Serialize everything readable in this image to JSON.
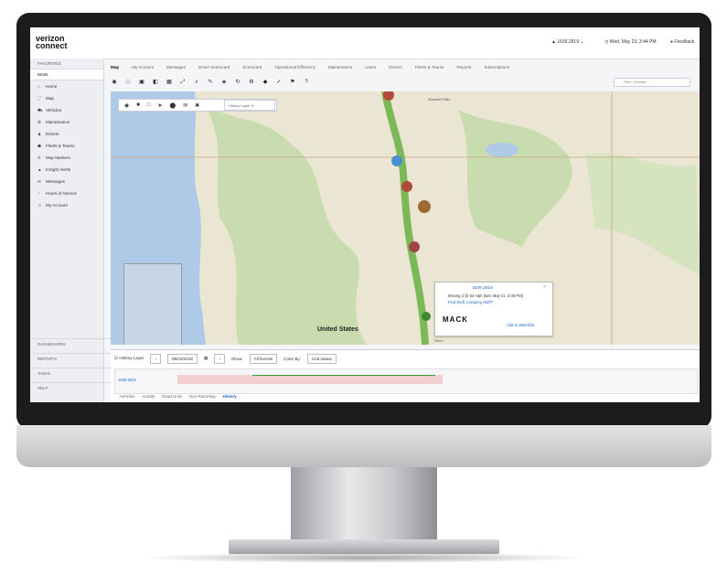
{
  "brand": {
    "logo_line1": "verizon",
    "logo_line2": "connect",
    "accent": "#cd040b"
  },
  "topbar": {
    "vehicles": "1639.2819",
    "datetime": "Wed, May 23, 3:44 PM",
    "feedback": "Feedback"
  },
  "sidebar": {
    "favorites": "FAVORITES",
    "main": "MAIN",
    "items": [
      {
        "icon": "home-icon",
        "label": "Home"
      },
      {
        "icon": "map-icon",
        "label": "Map"
      },
      {
        "icon": "truck-icon",
        "label": "Vehicles"
      },
      {
        "icon": "wrench-icon",
        "label": "Maintenance"
      },
      {
        "icon": "person-icon",
        "label": "Drivers"
      },
      {
        "icon": "people-icon",
        "label": "Fleets & Teams"
      },
      {
        "icon": "pin-icon",
        "label": "Map Markers"
      },
      {
        "icon": "alert-icon",
        "label": "InSight Alerts"
      },
      {
        "icon": "mail-icon",
        "label": "Messages"
      },
      {
        "icon": "clock-icon",
        "label": "Hours of Service"
      },
      {
        "icon": "user-icon",
        "label": "My Account"
      }
    ],
    "bottom": [
      "DASHBOARDS",
      "REPORTS",
      "TASKS",
      "HELP"
    ]
  },
  "tabs": [
    {
      "label": "Map",
      "active": true
    },
    {
      "label": "My Account"
    },
    {
      "label": "Messages"
    },
    {
      "label": "Driver Scorecard"
    },
    {
      "label": "Scorecard"
    },
    {
      "label": "Operational Efficiency"
    },
    {
      "label": "Maintenance"
    },
    {
      "label": "Users"
    },
    {
      "label": "Drivers"
    },
    {
      "label": "Fleets & Teams"
    },
    {
      "label": "Reports"
    },
    {
      "label": "Subscriptions"
    }
  ],
  "filter_placeholder": "Filter Vehicles",
  "map": {
    "history_layer": "History Layer",
    "places": [
      "Klamath Falls",
      "United States",
      "Reno"
    ],
    "popup": {
      "title": "1639.2819",
      "status": "Moving 3 @ 54 mph (last: May 21, 3:46 PM)",
      "link": "Find Stuff, Camping Stuff?",
      "brand": "MACK",
      "action": "Add to Watchlist"
    }
  },
  "history": {
    "checkbox": "History Layer",
    "date": "05/23/2018",
    "show_label": "Show:",
    "show_value": "All Events",
    "color_label": "Color By:",
    "color_value": "Unit status",
    "vehicle": "1639.2819",
    "tabs": [
      "Vehicles",
      "Activity",
      "Dead Units",
      "Non-Reporting",
      "History"
    ]
  }
}
